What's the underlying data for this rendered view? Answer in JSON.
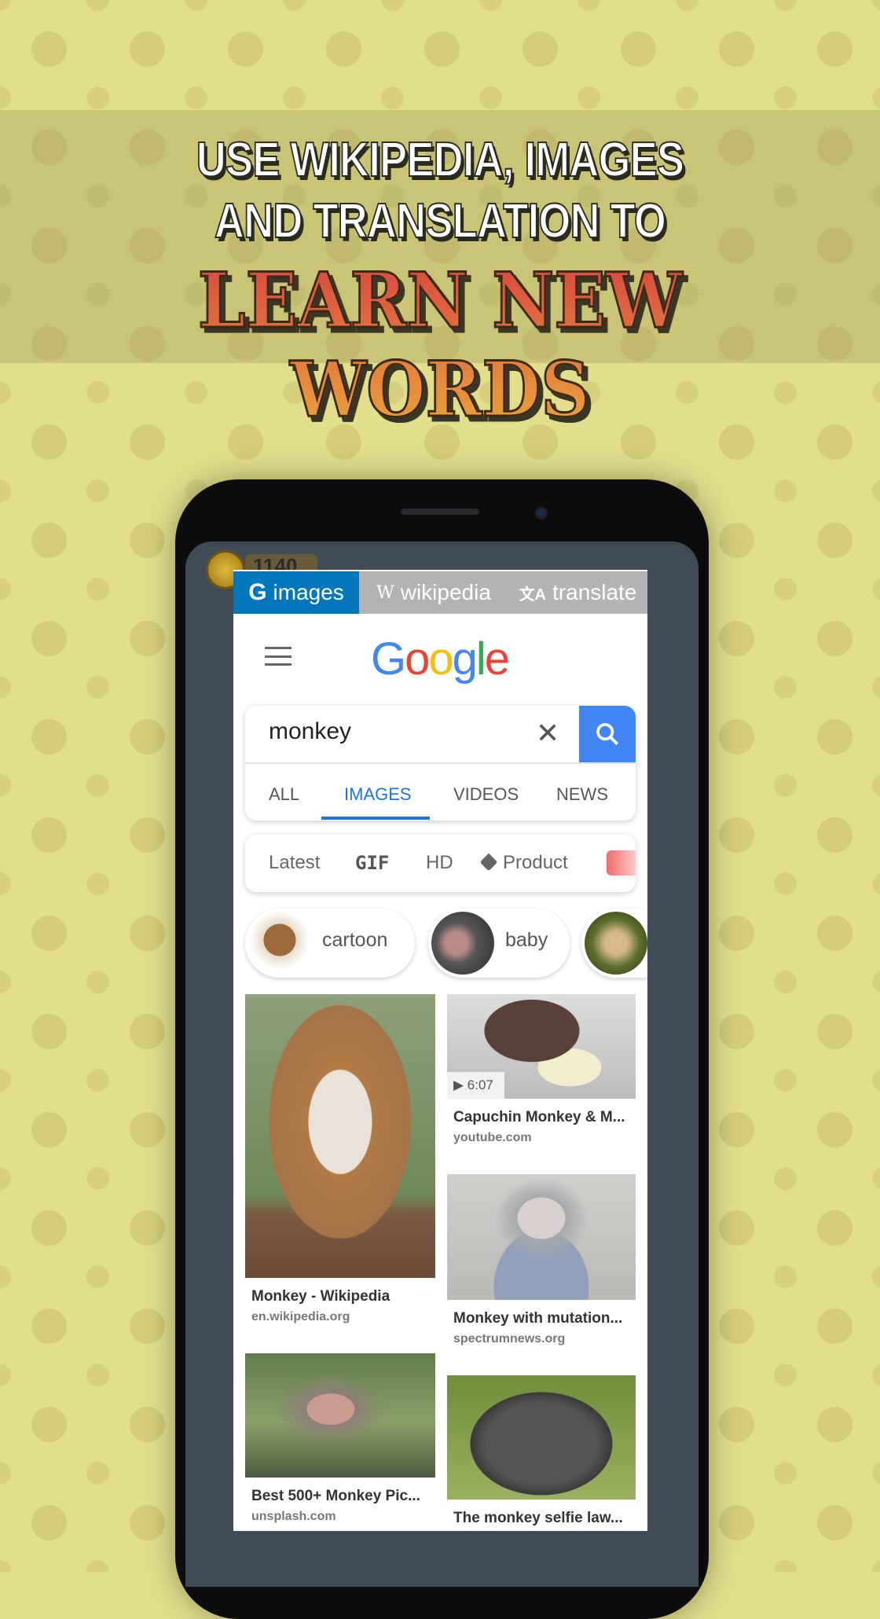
{
  "headline": {
    "line1": "USE WIKIPEDIA, IMAGES",
    "line2": "AND TRANSLATION TO",
    "line3": "LEARN NEW WORDS"
  },
  "game": {
    "coins": "1140"
  },
  "tabs": [
    {
      "icon": "G",
      "label": "images",
      "active": true
    },
    {
      "icon": "W",
      "label": "wikipedia"
    },
    {
      "icon": "文A",
      "label": "translate"
    }
  ],
  "google": {
    "logo": [
      "G",
      "o",
      "o",
      "g",
      "l",
      "e"
    ],
    "logo_colors": [
      "#4285f4",
      "#ea4335",
      "#fbbc05",
      "#4285f4",
      "#34a853",
      "#ea4335"
    ]
  },
  "search": {
    "value": "monkey",
    "clear": "✕",
    "tabs": [
      "ALL",
      "IMAGES",
      "VIDEOS",
      "NEWS"
    ],
    "active_tab": "IMAGES"
  },
  "filters": [
    "Latest",
    "GIF",
    "HD",
    "Product"
  ],
  "chips": [
    "cartoon",
    "baby"
  ],
  "results": [
    {
      "title": "Monkey - Wikipedia",
      "domain": "en.wikipedia.org"
    },
    {
      "title": "Capuchin Monkey & M...",
      "domain": "youtube.com",
      "duration": "6:07"
    },
    {
      "title": "Monkey with mutation...",
      "domain": "spectrumnews.org"
    },
    {
      "title": "Best 500+ Monkey Pic...",
      "domain": "unsplash.com"
    },
    {
      "title": "The monkey selfie law...",
      "domain": ""
    }
  ],
  "colors": {
    "tab_active": "#0277bd",
    "accent": "#1a73e8",
    "search_button": "#4285f4"
  }
}
